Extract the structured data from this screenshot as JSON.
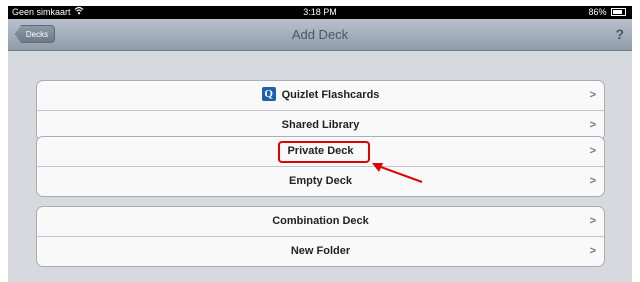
{
  "status_bar": {
    "carrier": "Geen simkaart",
    "wifi_icon": "wifi-icon",
    "time": "3:18 PM",
    "battery": "86%",
    "battery_icon": "battery-icon"
  },
  "nav_bar": {
    "back_label": "Decks",
    "title": "Add Deck",
    "help_label": "?"
  },
  "groups": [
    {
      "rows": [
        {
          "label": "Quizlet Flashcards",
          "icon": "Q",
          "chevron": ">"
        },
        {
          "label": "Shared Library",
          "chevron": ">"
        }
      ]
    },
    {
      "rows": [
        {
          "label": "Private Deck",
          "chevron": ">"
        },
        {
          "label": "Empty Deck",
          "chevron": ">"
        }
      ]
    },
    {
      "rows": [
        {
          "label": "Combination Deck",
          "chevron": ">"
        },
        {
          "label": "New Folder",
          "chevron": ">"
        }
      ]
    }
  ],
  "annotation": {
    "color": "#e00000"
  }
}
